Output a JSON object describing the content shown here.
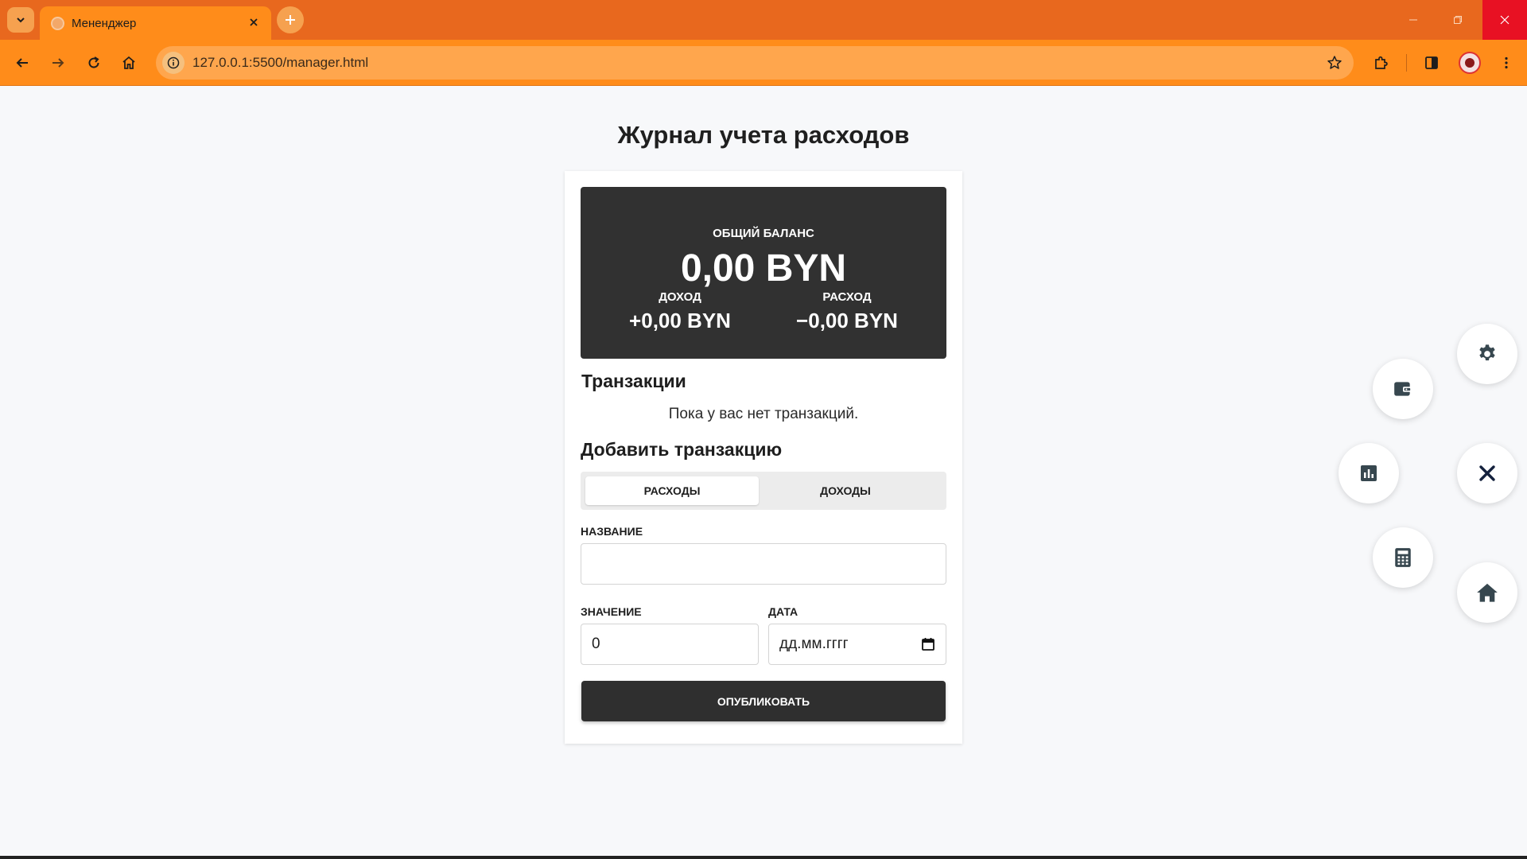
{
  "browser": {
    "tab_title": "Мененджер",
    "url": "127.0.0.1:5500/manager.html"
  },
  "page": {
    "title": "Журнал учета расходов"
  },
  "balance": {
    "label": "ОБЩИЙ БАЛАНС",
    "amount": "0,00 BYN",
    "income_label": "ДОХОД",
    "income_value": "+0,00 BYN",
    "expense_label": "РАСХОД",
    "expense_value": "−0,00 BYN"
  },
  "transactions": {
    "heading": "Транзакции",
    "empty_text": "Пока у вас нет транзакций."
  },
  "add_form": {
    "heading": "Добавить транзакцию",
    "tab_expense": "РАСХОДЫ",
    "tab_income": "ДОХОДЫ",
    "active_tab": "expense",
    "name_label": "НАЗВАНИЕ",
    "name_value": "",
    "amount_label": "ЗНАЧЕНИЕ",
    "amount_value": "0",
    "date_label": "ДАТА",
    "date_placeholder": "дд.мм.гггг",
    "submit_label": "ОПУБЛИКОВАТЬ"
  },
  "fab_menu": {
    "icons": [
      "gear-icon",
      "wallet-icon",
      "chart-icon",
      "close-icon",
      "calculator-icon",
      "home-icon"
    ]
  },
  "colors": {
    "chrome_tabbar": "#e8681e",
    "chrome_toolbar": "#ff8c1a",
    "balance_card": "#313131",
    "submit_button": "#2f2f2f",
    "page_bg": "#f7f8fa"
  }
}
